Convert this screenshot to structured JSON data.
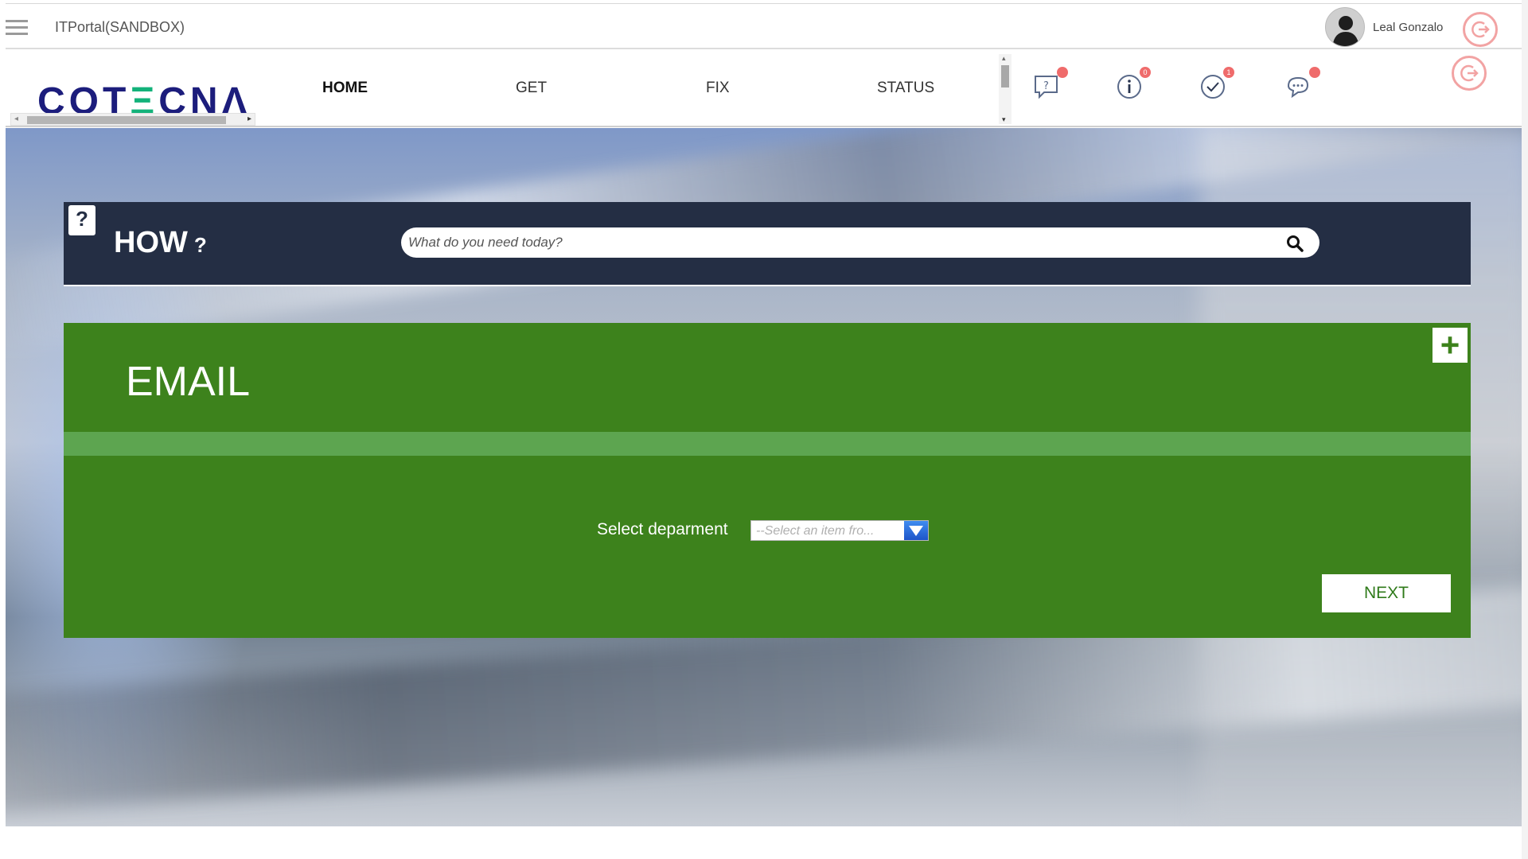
{
  "header": {
    "app_title": "ITPortal(SANDBOX)",
    "user_name": "Leal Gonzalo"
  },
  "logo": {
    "prefix": "COT",
    "accent": "Ξ",
    "suffix": "CNΛ"
  },
  "nav": {
    "items": [
      {
        "label": "HOME",
        "active": true
      },
      {
        "label": "GET"
      },
      {
        "label": "FIX"
      },
      {
        "label": "STATUS"
      }
    ],
    "icons": [
      {
        "name": "question-chat-icon",
        "badge": ""
      },
      {
        "name": "info-icon",
        "badge": "0"
      },
      {
        "name": "check-icon",
        "badge": "1"
      },
      {
        "name": "comments-icon",
        "badge": ""
      }
    ]
  },
  "how": {
    "title": "HOW",
    "question_mark": "?",
    "icon_glyph": "?",
    "search_placeholder": "What do you need today?"
  },
  "email_card": {
    "title": "EMAIL",
    "add_glyph": "+",
    "department_label": "Select deparment",
    "department_placeholder": "--Select an item fro...",
    "next_label": "NEXT"
  },
  "colors": {
    "card_green": "#3d821c",
    "stripe_green": "#5da550",
    "how_bar": "#242e44",
    "logo_blue": "#1c1d7c",
    "logo_accent": "#13b27a",
    "badge_red": "#ef6b6b",
    "logout_ring": "#f2a3a3"
  }
}
